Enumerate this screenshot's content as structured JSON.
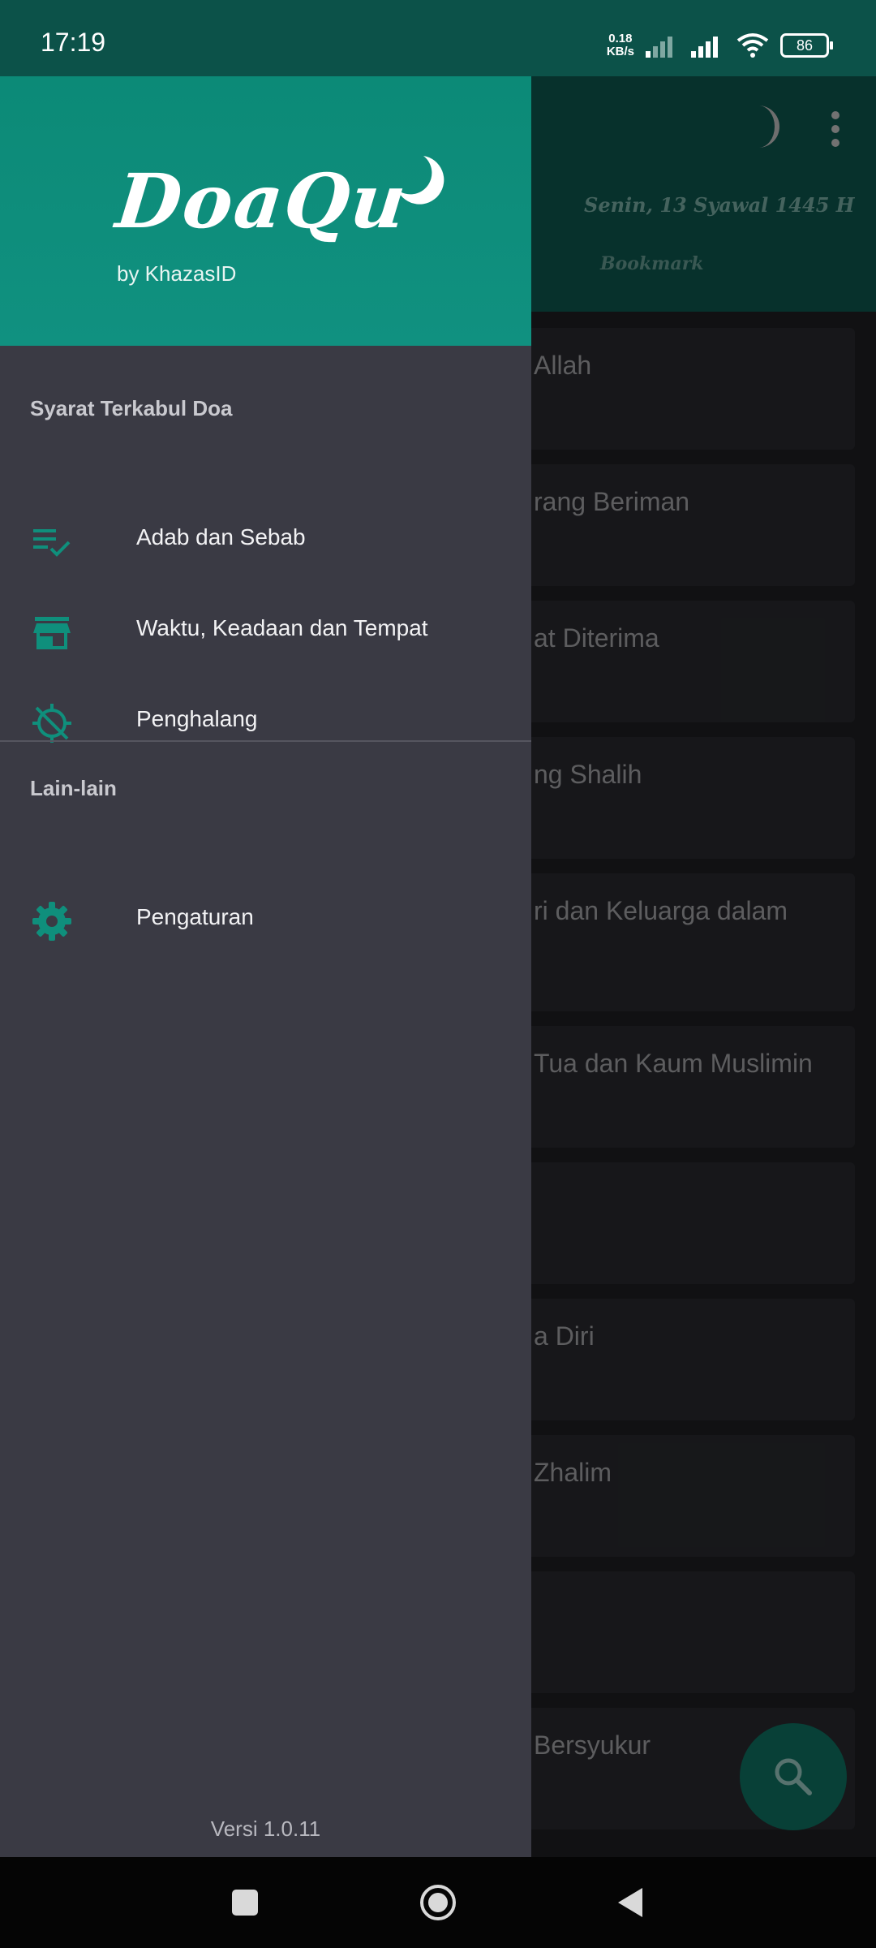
{
  "status_bar": {
    "time": "17:19",
    "net_speed_value": "0.18",
    "net_speed_unit": "KB/s",
    "battery": "86"
  },
  "app": {
    "date": "Senin, 13 Syawal 1445 H",
    "tab_bookmark": "Bookmark",
    "list_items": [
      "Allah",
      "rang Beriman",
      "at Diterima",
      "ng Shalih",
      "ri dan Keluarga dalam",
      "Tua dan Kaum Muslimin",
      "",
      "a Diri",
      "Zhalim",
      "",
      "Bersyukur"
    ]
  },
  "drawer": {
    "logo": "DoaQu",
    "subtitle": "by KhazasID",
    "section1_title": "Syarat Terkabul Doa",
    "section1_items": [
      {
        "label": "Adab dan Sebab",
        "icon": "playlist-check-icon"
      },
      {
        "label": "Waktu, Keadaan dan Tempat",
        "icon": "store-icon"
      },
      {
        "label": "Penghalang",
        "icon": "gps-off-icon"
      }
    ],
    "section2_title": "Lain-lain",
    "section2_items": [
      {
        "label": "Pengaturan",
        "icon": "gear-icon"
      }
    ],
    "version": "Versi 1.0.11"
  },
  "colors": {
    "accent": "#0c8a77",
    "drawer_bg": "#3a3a44",
    "header_dark": "#0e5a50",
    "icon_teal": "#0f8f7c"
  }
}
